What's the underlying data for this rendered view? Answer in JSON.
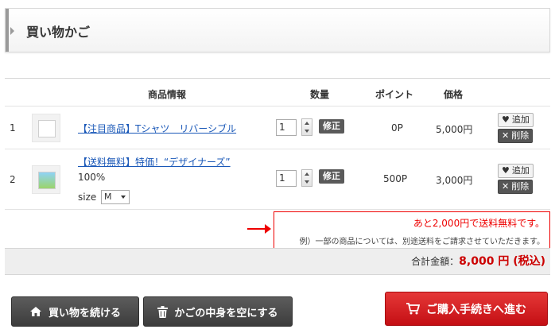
{
  "header": {
    "title": "買い物かご"
  },
  "table": {
    "columns": {
      "product": "商品情報",
      "qty": "数量",
      "points": "ポイント",
      "price": "価格"
    },
    "rows": [
      {
        "index": "1",
        "name": "【注目商品】Tシャツ　リバーシブル",
        "qty": "1",
        "update_label": "修正",
        "points": "0P",
        "price": "5,000円",
        "add_label": "追加",
        "delete_label": "削除"
      },
      {
        "index": "2",
        "name": "【送料無料】特価！“デザイナーズ”",
        "option_text": "100%",
        "size_label": "size",
        "size_value": "M",
        "qty": "1",
        "update_label": "修正",
        "points": "500P",
        "price": "3,000円",
        "add_label": "追加",
        "delete_label": "削除"
      }
    ]
  },
  "notice": {
    "main": "あと2,000円で送料無料です。",
    "sub": "例）一部の商品については、別途送料をご請求させていただきます。"
  },
  "total": {
    "label": "合計金額：",
    "amount": "8,000 円 (税込)"
  },
  "buttons": {
    "continue": "買い物を続ける",
    "empty": "かごの中身を空にする",
    "checkout": "ご購入手続きへ進む"
  },
  "icons": {
    "home": "home-icon",
    "trash": "trash-icon",
    "cart": "cart-icon",
    "heart": "heart-icon",
    "close": "close-icon"
  },
  "colors": {
    "accent": "#e00000",
    "link": "#1a58b8",
    "dark_button": "#4a4a4a",
    "checkout": "#d41c20"
  }
}
